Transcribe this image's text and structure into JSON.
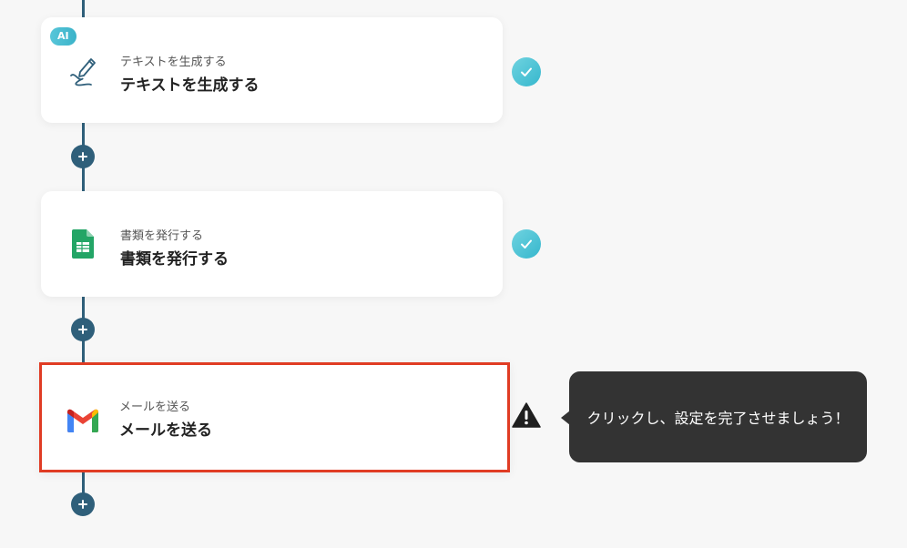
{
  "steps": [
    {
      "badge": "AI",
      "subtitle": "テキストを生成する",
      "title": "テキストを生成する",
      "icon": "pen-squiggle-icon",
      "status": "complete"
    },
    {
      "subtitle": "書類を発行する",
      "title": "書類を発行する",
      "icon": "google-sheets-icon",
      "status": "complete"
    },
    {
      "subtitle": "メールを送る",
      "title": "メールを送る",
      "icon": "gmail-icon",
      "status": "warning"
    }
  ],
  "tooltip": {
    "text": "クリックし、設定を完了させましょう！"
  },
  "colors": {
    "flow_line": "#2f5f7a",
    "check": "#36b7cd",
    "selected_border": "#e03c24",
    "tooltip_bg": "#333333"
  }
}
